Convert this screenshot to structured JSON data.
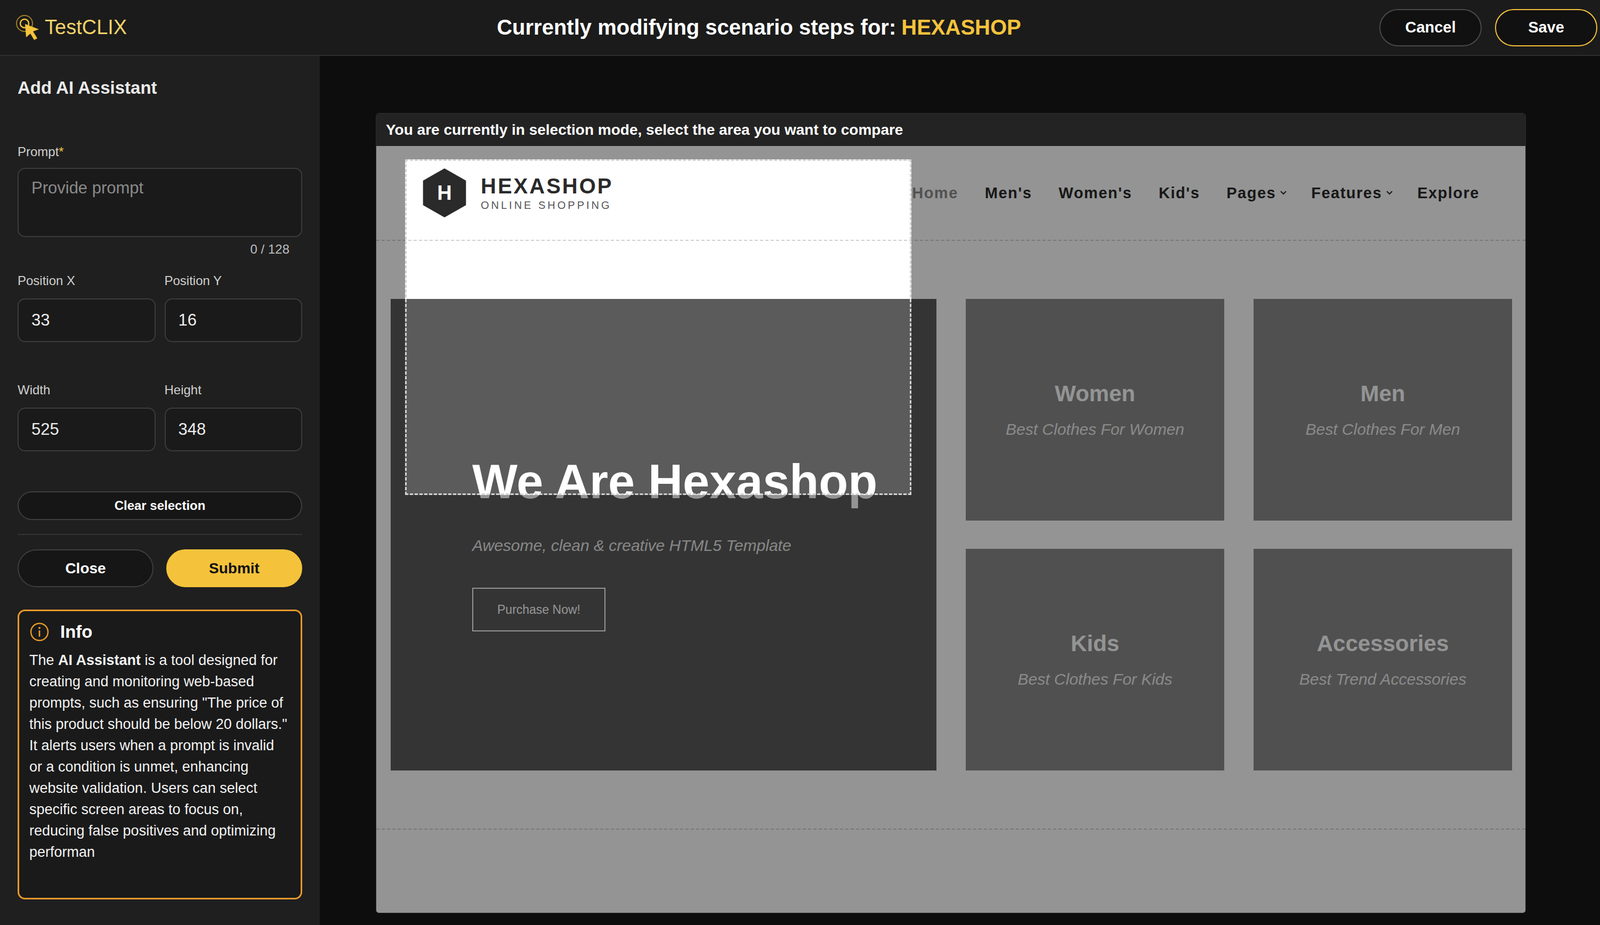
{
  "app": {
    "logo": "TestCLIX"
  },
  "header": {
    "title_prefix": "Currently modifying scenario steps for:",
    "project": "HEXASHOP",
    "buttons": [
      {
        "label": "Cancel",
        "kind": "secondary"
      },
      {
        "label": "Save",
        "kind": "primary"
      }
    ]
  },
  "panel": {
    "title": "Add AI Assistant",
    "prompt": {
      "label": "Prompt",
      "required_mark": "*",
      "placeholder": "Provide prompt",
      "counter": "0 / 128"
    },
    "fields": [
      {
        "label": "Position X",
        "value": "33"
      },
      {
        "label": "Position Y",
        "value": "16"
      },
      {
        "label": "Width",
        "value": "525"
      },
      {
        "label": "Height",
        "value": "348"
      }
    ],
    "clear_button": "Clear selection",
    "actions": [
      {
        "label": "Close",
        "kind": "secondary"
      },
      {
        "label": "Submit",
        "kind": "primary"
      }
    ],
    "info": {
      "title": "Info",
      "parts": [
        {
          "text": "The ",
          "bold": false
        },
        {
          "text": "AI Assistant",
          "bold": true
        },
        {
          "text": " is a tool designed for creating and monitoring web-based prompts, such as ensuring \"The price of this product should be below 20 dollars.\" It alerts users when a prompt is invalid or a condition is unmet, enhancing website validation. Users can select specific screen areas to focus on, reducing false positives and optimizing performan",
          "bold": false
        }
      ]
    }
  },
  "preview": {
    "notice": "You are currently in selection mode, select the area you want to compare",
    "site": {
      "logo_mark": "H",
      "brand": "HEXASHOP",
      "tagline": "ONLINE SHOPPING",
      "nav": [
        {
          "label": "Home",
          "selected": true,
          "dropdown": false
        },
        {
          "label": "Men's",
          "selected": false,
          "dropdown": false
        },
        {
          "label": "Women's",
          "selected": false,
          "dropdown": false
        },
        {
          "label": "Kid's",
          "selected": false,
          "dropdown": false
        },
        {
          "label": "Pages",
          "selected": false,
          "dropdown": true
        },
        {
          "label": "Features",
          "selected": false,
          "dropdown": true
        },
        {
          "label": "Explore",
          "selected": false,
          "dropdown": false
        }
      ],
      "hero": {
        "title": "We Are Hexashop",
        "subtitle": "Awesome, clean & creative HTML5 Template",
        "button": "Purchase Now!"
      },
      "categories": [
        {
          "title": "Women",
          "subtitle": "Best Clothes For Women"
        },
        {
          "title": "Men",
          "subtitle": "Best Clothes For Men"
        },
        {
          "title": "Kids",
          "subtitle": "Best Clothes For Kids"
        },
        {
          "title": "Accessories",
          "subtitle": "Best Trend Accessories"
        }
      ]
    }
  }
}
